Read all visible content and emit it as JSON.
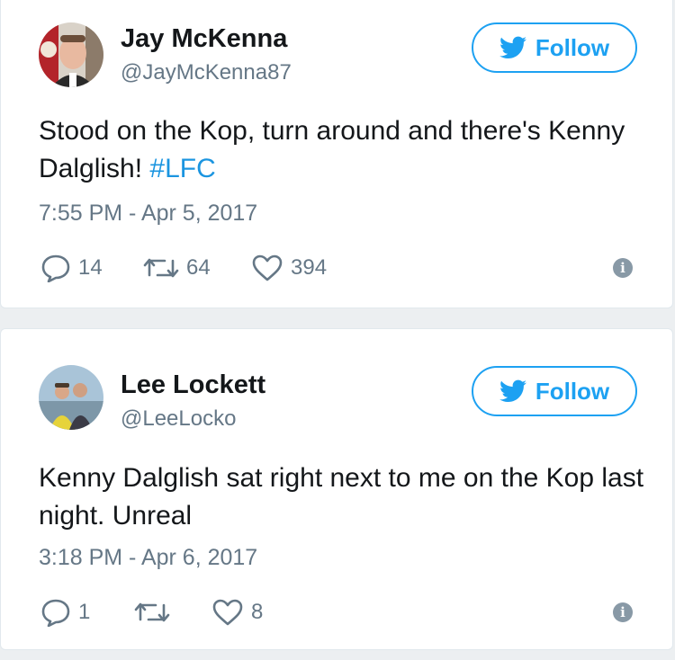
{
  "follow_label": "Follow",
  "colors": {
    "accent": "#1da1f2",
    "hashtag": "#1b95e0",
    "muted": "#657786",
    "info_icon": "#8899a6"
  },
  "tweets": [
    {
      "name": "Jay McKenna",
      "handle": "@JayMcKenna87",
      "text": "Stood on the Kop, turn around and there's Kenny Dalglish! ",
      "hashtag": "#LFC",
      "timestamp": "7:55 PM - Apr 5, 2017",
      "replies": "14",
      "retweets": "64",
      "likes": "394"
    },
    {
      "name": "Lee Lockett",
      "handle": "@LeeLocko",
      "text": "Kenny Dalglish sat right next to me on the Kop last night. Unreal",
      "hashtag": "",
      "timestamp": "3:18 PM - Apr 6, 2017",
      "replies": "1",
      "retweets": "",
      "likes": "8"
    }
  ]
}
